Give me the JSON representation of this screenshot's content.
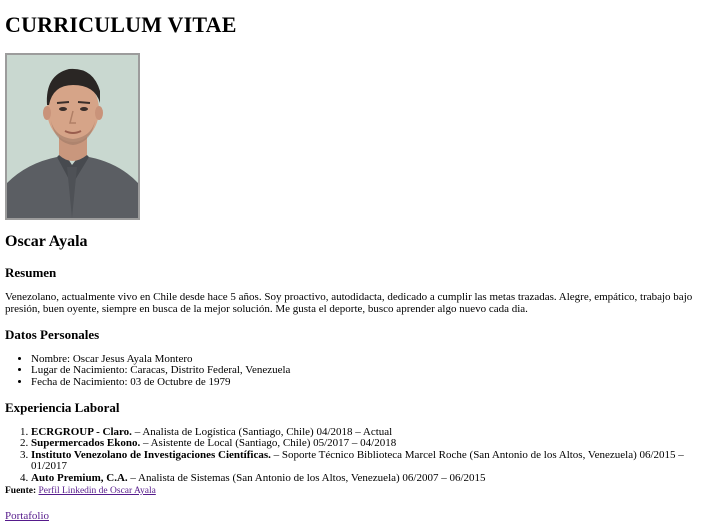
{
  "title": "CURRICULUM VITAE",
  "name": "Oscar Ayala",
  "summary": {
    "heading": "Resumen",
    "text": "Venezolano, actualmente vivo en Chile desde hace 5 años. Soy proactivo, autodidacta, dedicado a cumplir las metas trazadas. Alegre, empático, trabajo bajo presión, buen oyente, siempre en busca de la mejor solución. Me gusta el deporte, busco aprender algo nuevo cada dia."
  },
  "personal": {
    "heading": "Datos Personales",
    "items": [
      "Nombre: Oscar Jesus Ayala Montero",
      "Lugar de Nacimiento: Caracas, Distrito Federal, Venezuela",
      "Fecha de Nacimiento: 03 de Octubre de 1979"
    ]
  },
  "experience": {
    "heading": "Experiencia Laboral",
    "items": [
      {
        "company": "ECRGROUP - Claro.",
        "detail": " – Analista de Logística (Santiago, Chile) 04/2018 – Actual"
      },
      {
        "company": "Supermercados Ekono.",
        "detail": " – Asistente de Local (Santiago, Chile) 05/2017 – 04/2018"
      },
      {
        "company": "Instituto Venezolano de Investigaciones Científicas.",
        "detail": " – Soporte Técnico Biblioteca Marcel Roche (San Antonio de los Altos, Venezuela) 06/2015 – 01/2017"
      },
      {
        "company": "Auto Premium, C.A.",
        "detail": " – Analista de Sistemas (San Antonio de los Altos, Venezuela) 06/2007 – 06/2015"
      }
    ]
  },
  "source": {
    "label": "Fuente:",
    "link_text": "Perfil Linkedin de Oscar Ayala"
  },
  "portfolio_link": "Portafolio"
}
